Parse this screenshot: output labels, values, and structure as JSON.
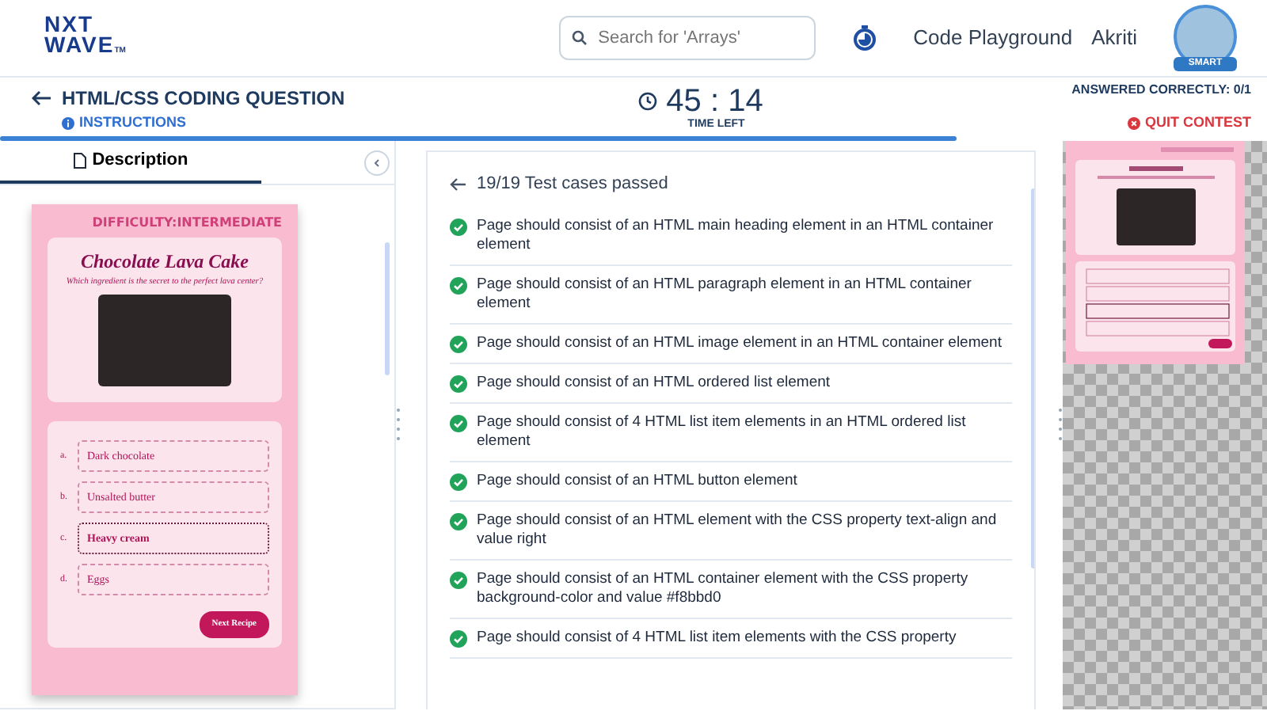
{
  "header": {
    "logo": {
      "line_1": "NXT",
      "line_2": "WAVE",
      "mark": "TM"
    },
    "search": {
      "placeholder": "Search for 'Arrays'"
    },
    "nav_links": [
      "Code Playground",
      "Akriti"
    ],
    "avatar": {
      "badge": "SMART"
    }
  },
  "question_bar": {
    "title": "HTML/CSS CODING QUESTION",
    "instructions": "INSTRUCTIONS",
    "timer": "45 : 14",
    "timer_label": "TIME LEFT",
    "answered": "ANSWERED CORRECTLY: 0/1",
    "quit": "QUIT CONTEST",
    "progress": {
      "level": 0.755
    }
  },
  "description_panel": {
    "tabs": [
      {
        "label": "Description",
        "selected": true
      }
    ],
    "preview": {
      "difficulty": "DIFFICULTY:INTERMEDIATE",
      "title": "Chocolate Lava Cake",
      "subtitle": "Which ingredient is the secret to the perfect lava center?",
      "options": [
        {
          "letter": "a.",
          "text": "Dark chocolate",
          "selected": false
        },
        {
          "letter": "b.",
          "text": "Unsalted butter",
          "selected": false
        },
        {
          "letter": "c.",
          "text": "Heavy cream",
          "selected": true
        },
        {
          "letter": "d.",
          "text": "Eggs",
          "selected": false
        }
      ],
      "button": "Next Recipe"
    }
  },
  "results": {
    "summary": "19/19 Test cases passed",
    "tests": [
      {
        "text": "Page should consist of an HTML main heading element in an HTML container element",
        "passed": true
      },
      {
        "text": "Page should consist of an HTML paragraph element in an HTML container element",
        "passed": true
      },
      {
        "text": "Page should consist of an HTML image element in an HTML container element",
        "passed": true
      },
      {
        "text": "Page should consist of an HTML ordered list element",
        "passed": true
      },
      {
        "text": "Page should consist of 4 HTML list item elements in an HTML ordered list element",
        "passed": true
      },
      {
        "text": "Page should consist of an HTML button element",
        "passed": true
      },
      {
        "text": "Page should consist of an HTML element with the CSS property text-align and value right",
        "passed": true
      },
      {
        "text": "Page should consist of an HTML container element with the CSS property background-color and value #f8bbd0",
        "passed": true
      },
      {
        "text": "Page should consist of 4 HTML list item elements with the CSS property",
        "passed": true
      }
    ]
  }
}
